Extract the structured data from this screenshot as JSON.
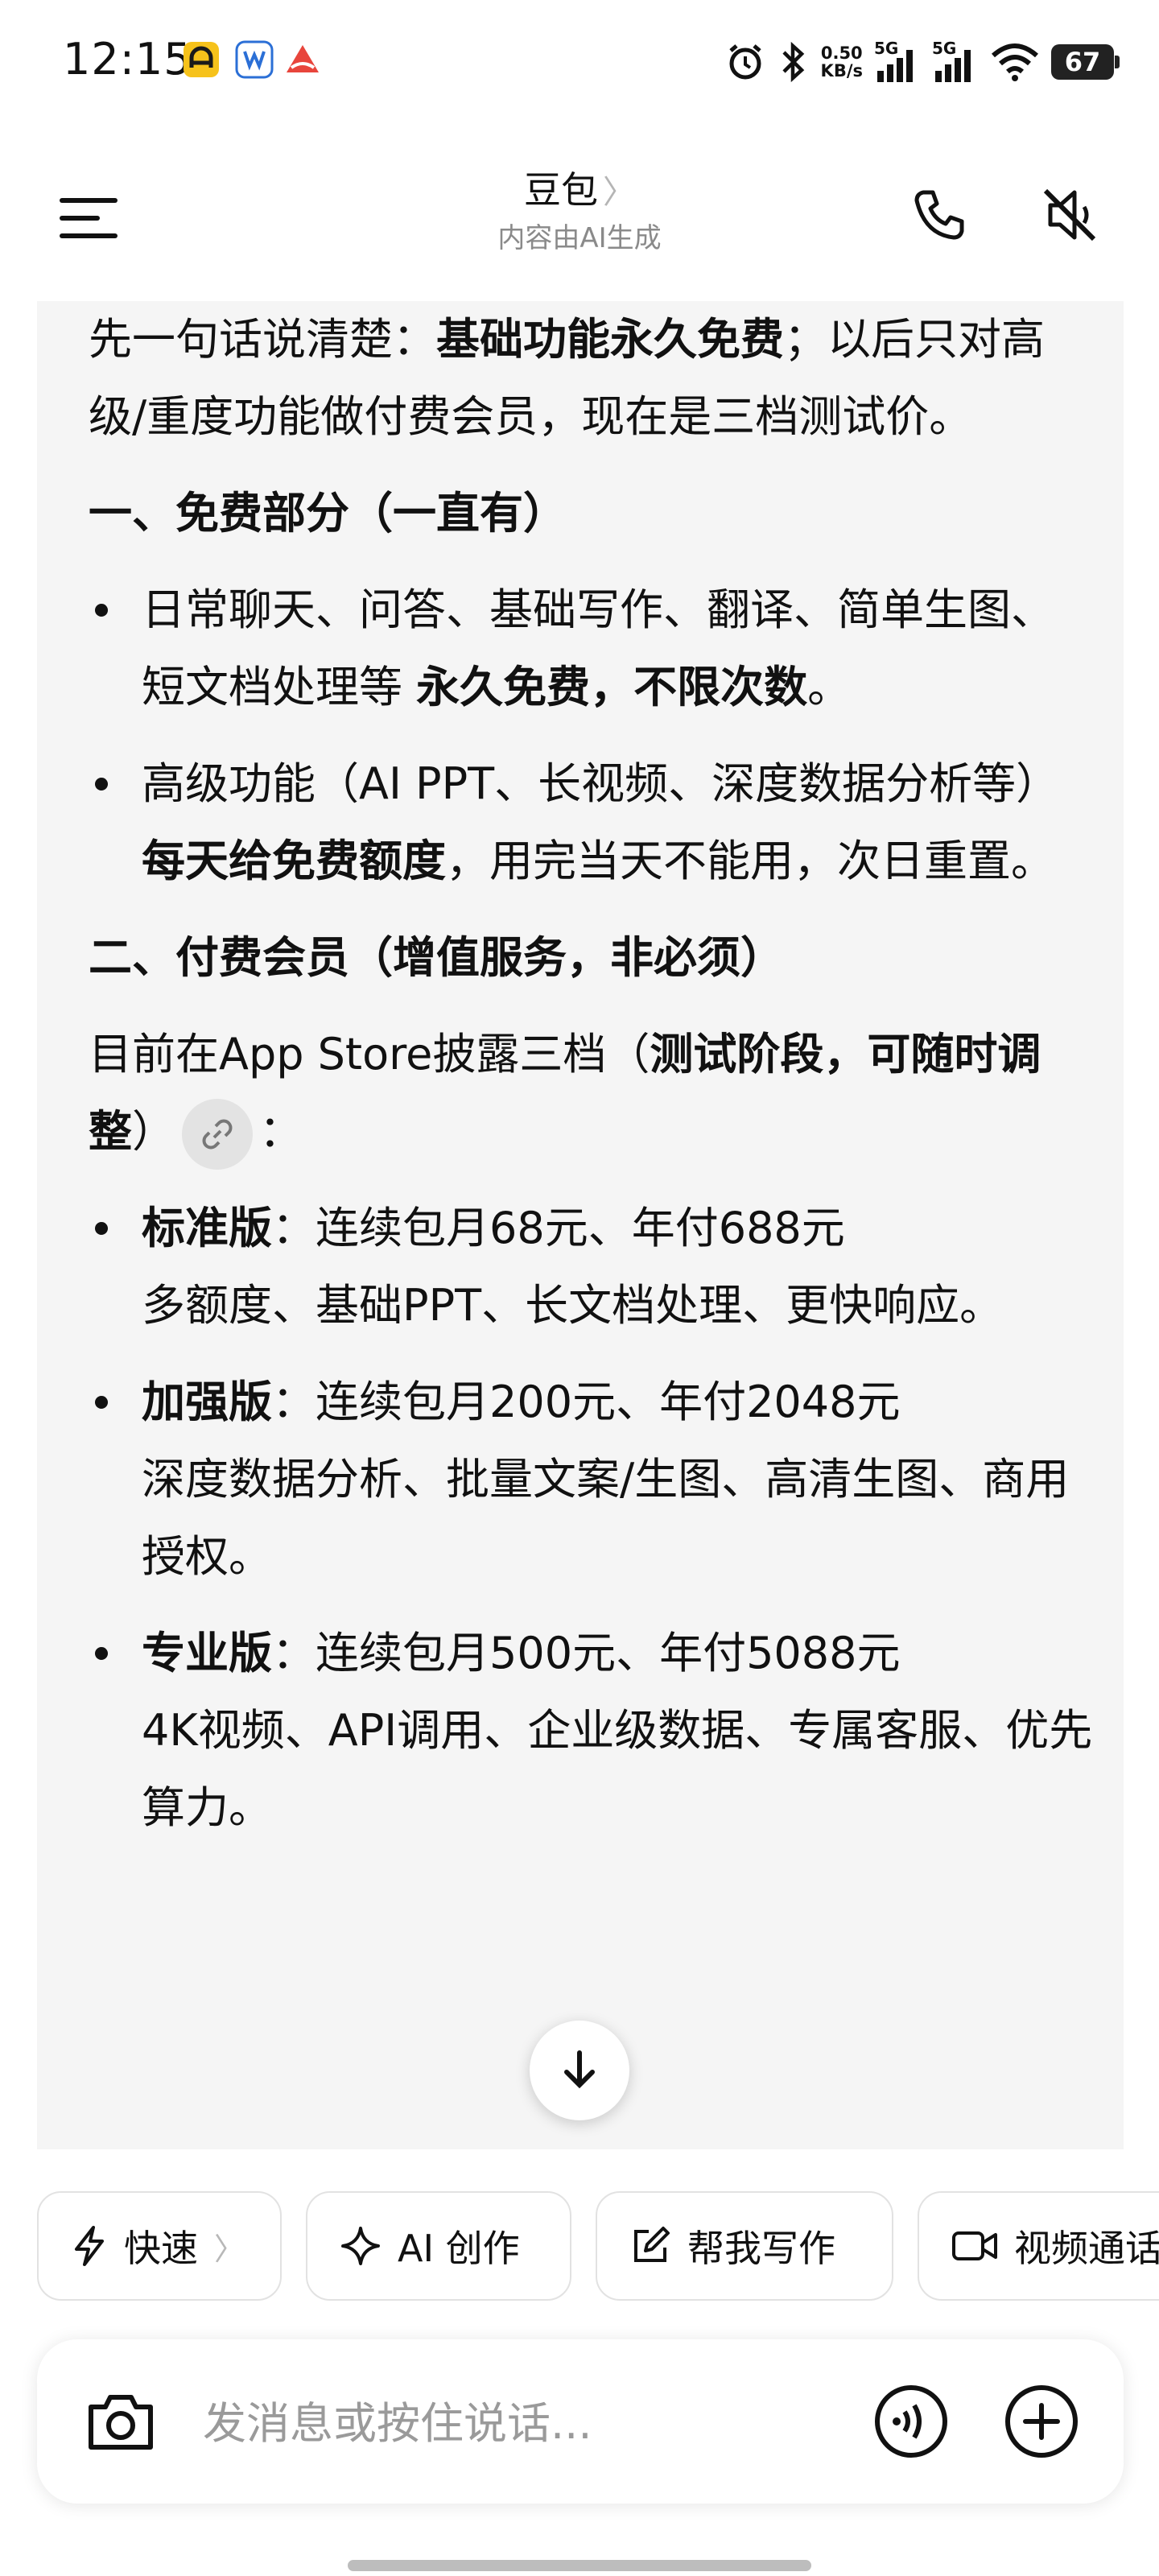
{
  "status_bar": {
    "time": "12:15",
    "net_speed_value": "0.50",
    "net_speed_unit": "KB/s",
    "sim1": "5G",
    "sim2": "5G",
    "battery": "67"
  },
  "header": {
    "title": "豆包",
    "subtitle": "内容由AI生成"
  },
  "content": {
    "intro_prefix": "先一句话说清楚：",
    "intro_bold": "基础功能永久免费",
    "intro_suffix": "；以后只对高级/重度功能做付费会员，现在是三档测试价。",
    "section1": "一、免费部分（一直有）",
    "free_item1_text": "日常聊天、问答、基础写作、翻译、简单生图、短文档处理等 ",
    "free_item1_bold": "永久免费，不限次数",
    "free_item1_end": "。",
    "free_item2_text": "高级功能（AI PPT、长视频、深度数据分析等）",
    "free_item2_bold": "每天给免费额度",
    "free_item2_end": "，用完当天不能用，次日重置。",
    "section2": "二、付费会员（增值服务，非必须）",
    "paid_intro_text": "目前在App Store披露三档（",
    "paid_intro_bold": "测试阶段，可随时调整",
    "paid_intro_end": "）",
    "paid_intro_colon": "：",
    "tiers": [
      {
        "name": "标准版",
        "price": "：连续包月68元、年付688元",
        "desc": "多额度、基础PPT、长文档处理、更快响应。"
      },
      {
        "name": "加强版",
        "price": "：连续包月200元、年付2048元",
        "desc": "深度数据分析、批量文案/生图、高清生图、商用授权。"
      },
      {
        "name": "专业版",
        "price": "：连续包月500元、年付5088元",
        "desc": "4K视频、API调用、企业级数据、专属客服、优先算力。"
      }
    ]
  },
  "quick_actions": [
    {
      "label": "快速",
      "has_chevron": true,
      "chevron": "〉"
    },
    {
      "label": "AI 创作"
    },
    {
      "label": "帮我写作"
    },
    {
      "label": "视频通话"
    }
  ],
  "input": {
    "placeholder": "发消息或按住说话..."
  },
  "colors": {
    "card_bg": "#f5f5f5",
    "text": "#111111",
    "muted": "#8a8a8a"
  }
}
